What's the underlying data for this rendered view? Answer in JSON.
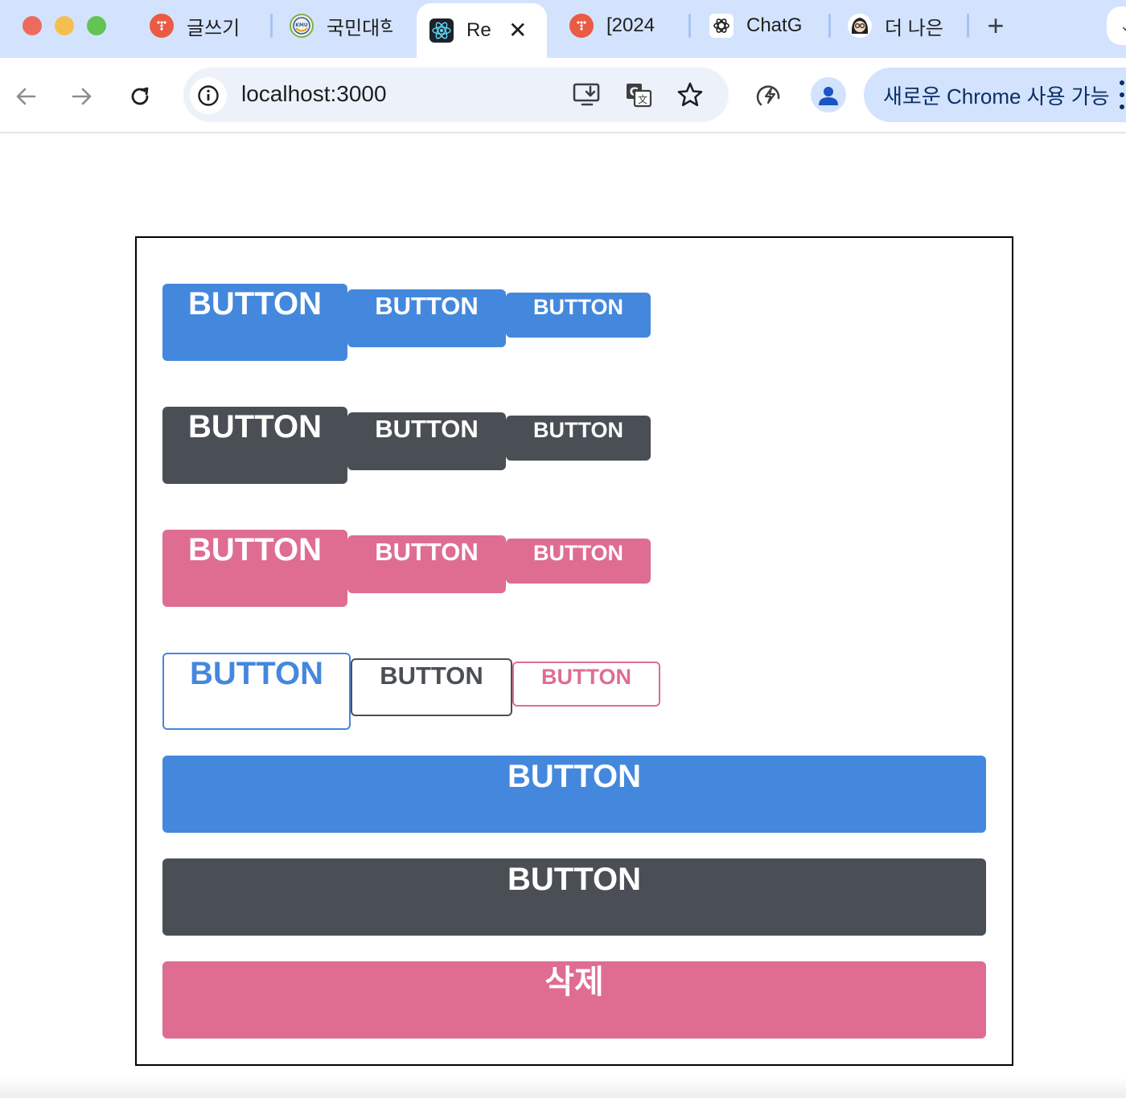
{
  "browser": {
    "tabs": [
      {
        "title": "글쓰기",
        "favicon": "tistory-icon",
        "favicon_color": "#eb5a43",
        "active": false
      },
      {
        "title": "국민대학",
        "favicon": "kmu-logo-icon",
        "favicon_color": "#e8e8e8",
        "active": false
      },
      {
        "title": "Re",
        "favicon": "react-icon",
        "favicon_color": "#1e2229",
        "active": true
      },
      {
        "title": "[2024",
        "favicon": "tistory-icon",
        "favicon_color": "#eb5a43",
        "active": false
      },
      {
        "title": "ChatG",
        "favicon": "chatgpt-icon",
        "favicon_color": "#ffffff",
        "active": false
      },
      {
        "title": "더 나은",
        "favicon": "avatar-icon",
        "favicon_color": "#ffffff",
        "active": false
      }
    ],
    "new_tab_label": "+",
    "close_tab_label": "✕",
    "url": "localhost:3000",
    "update_chip": "새로운 Chrome 사용 가능"
  },
  "page": {
    "rows": [
      {
        "variant": "filled-blue",
        "buttons": [
          {
            "label": "BUTTON",
            "size": "large"
          },
          {
            "label": "BUTTON",
            "size": "medium"
          },
          {
            "label": "BUTTON",
            "size": "small"
          }
        ]
      },
      {
        "variant": "filled-dark",
        "buttons": [
          {
            "label": "BUTTON",
            "size": "large"
          },
          {
            "label": "BUTTON",
            "size": "medium"
          },
          {
            "label": "BUTTON",
            "size": "small"
          }
        ]
      },
      {
        "variant": "filled-pink",
        "buttons": [
          {
            "label": "BUTTON",
            "size": "large"
          },
          {
            "label": "BUTTON",
            "size": "medium"
          },
          {
            "label": "BUTTON",
            "size": "small"
          }
        ]
      },
      {
        "variant": "outline-mixed",
        "buttons": [
          {
            "label": "BUTTON",
            "size": "large",
            "color": "blue"
          },
          {
            "label": "BUTTON",
            "size": "medium",
            "color": "dark"
          },
          {
            "label": "BUTTON",
            "size": "small",
            "color": "pink"
          }
        ]
      }
    ],
    "full_width_buttons": [
      {
        "label": "BUTTON",
        "color": "blue"
      },
      {
        "label": "BUTTON",
        "color": "dark"
      },
      {
        "label": "삭제",
        "color": "pink"
      }
    ]
  },
  "colors": {
    "blue": "#4488dd",
    "dark": "#4a4f56",
    "pink": "#de6d91",
    "tab_strip": "#d3e3fd"
  }
}
